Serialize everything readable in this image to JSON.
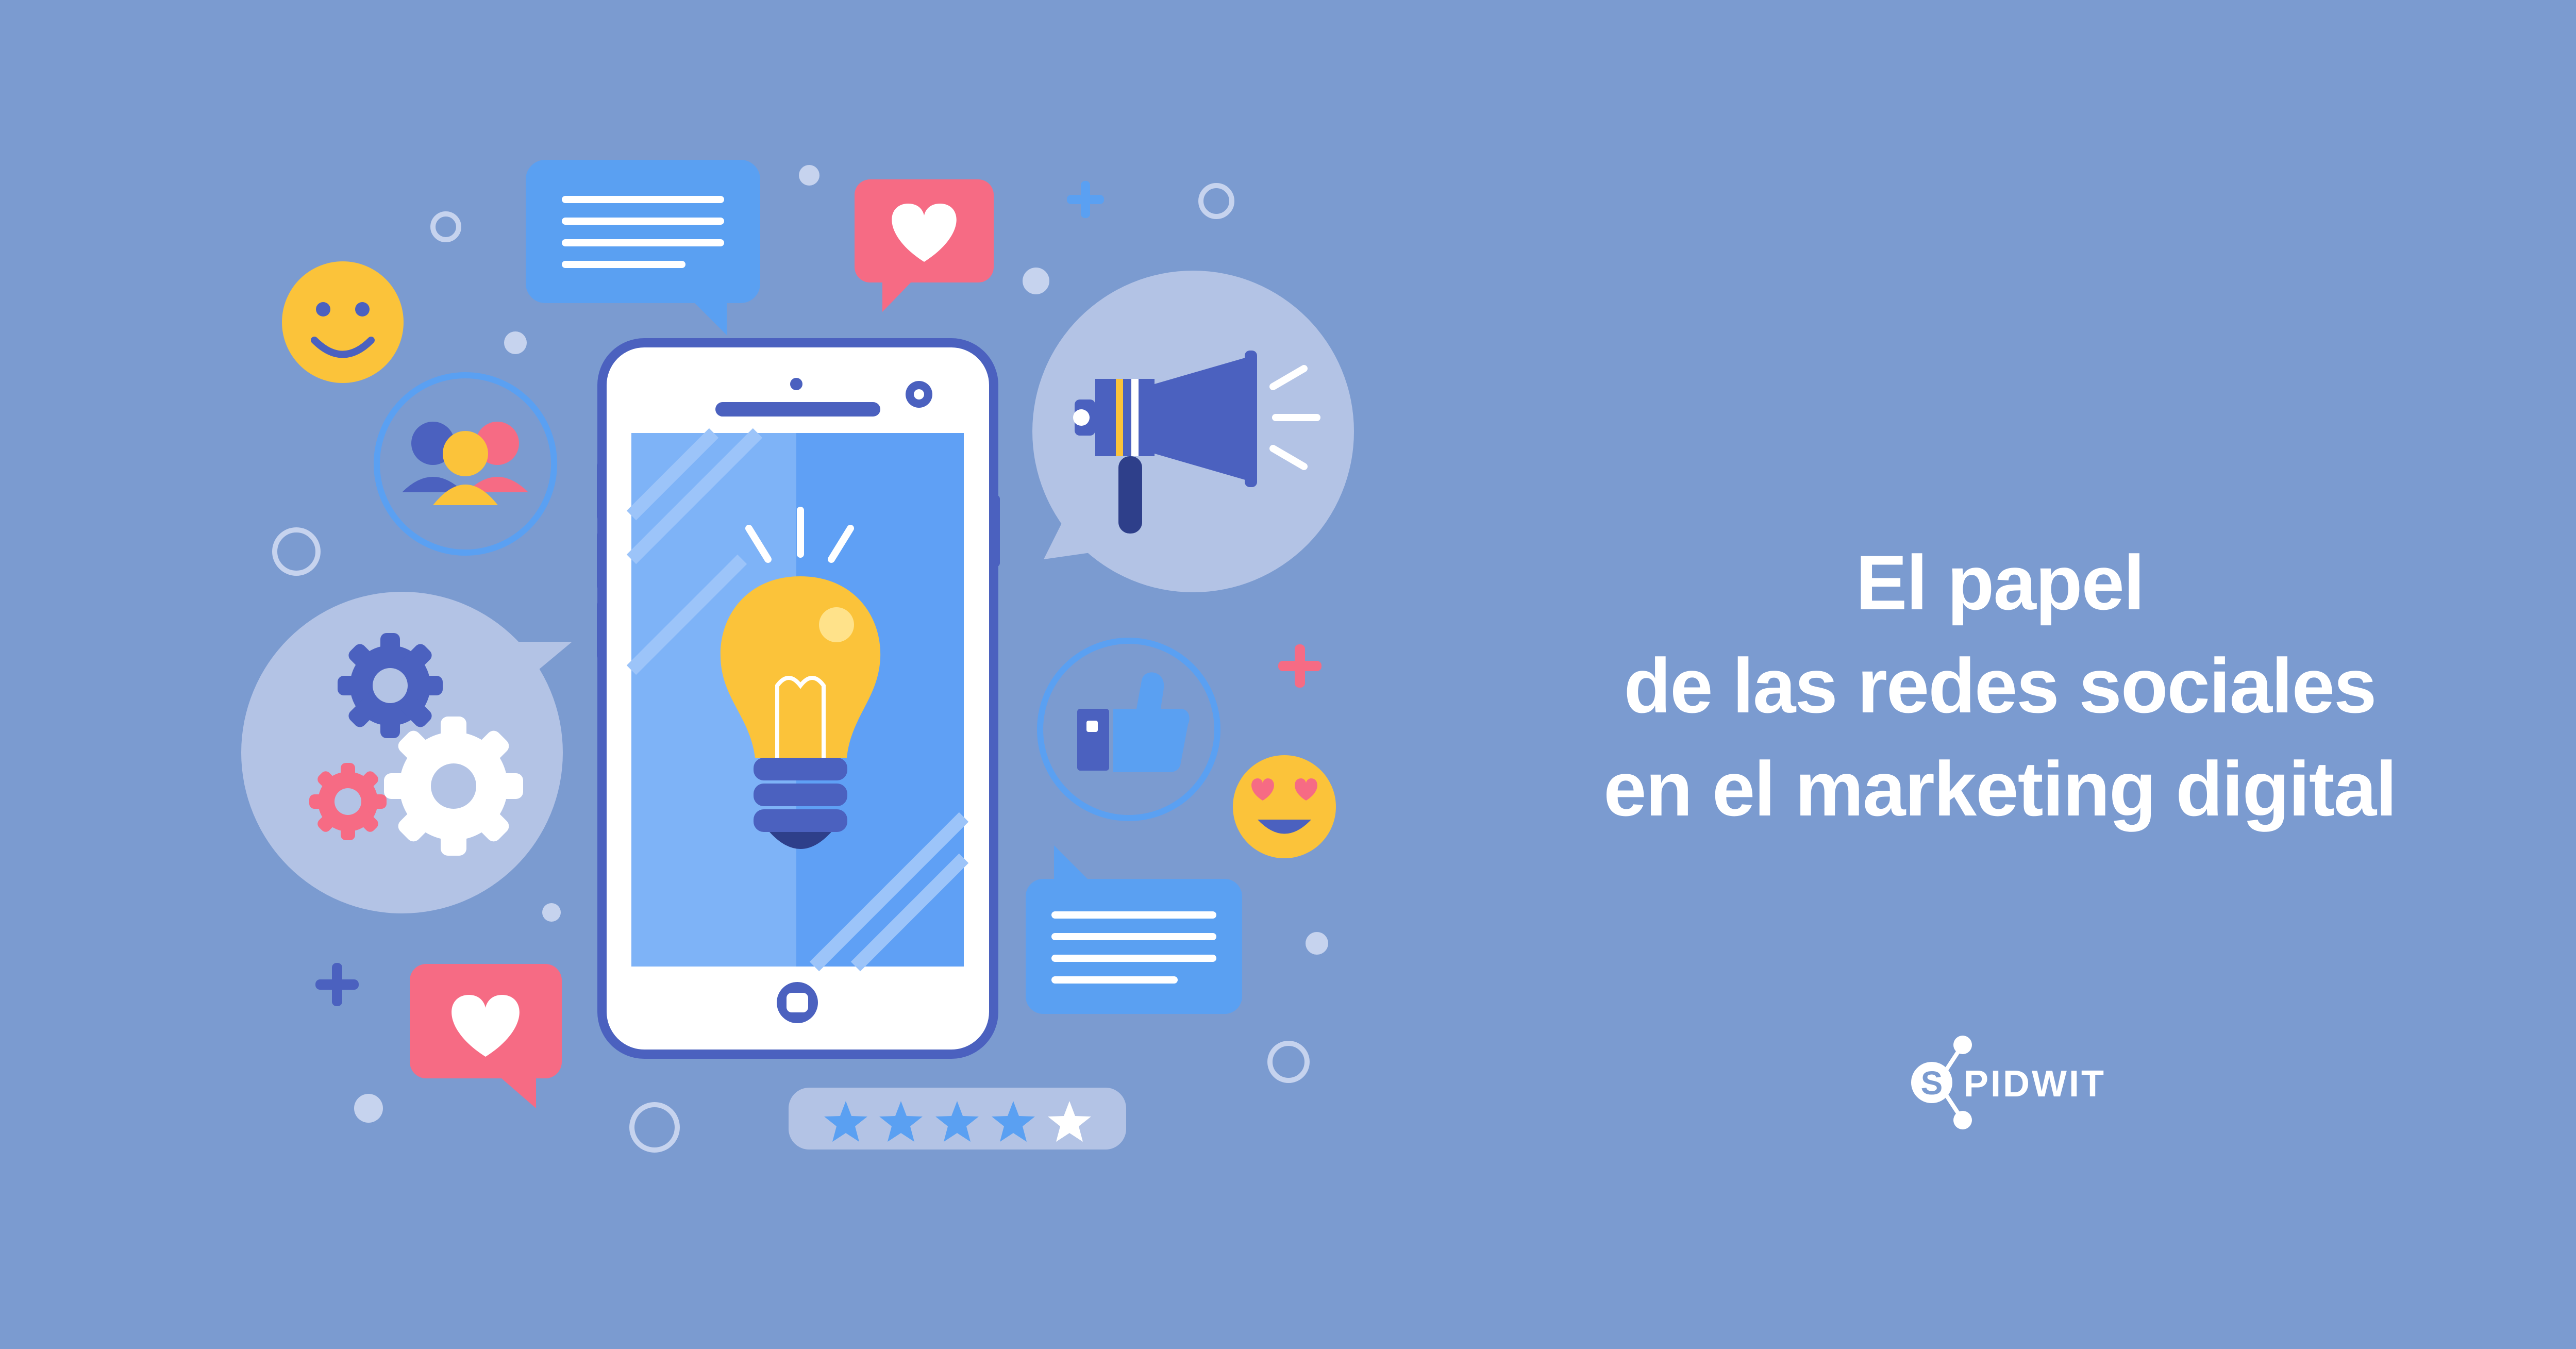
{
  "headline": {
    "line1": "El papel",
    "line2": "de las redes sociales",
    "line3": "en el marketing digital"
  },
  "brand": {
    "text": "PIDWIT",
    "logo_letter": "S"
  },
  "rating": {
    "stars_filled": 4,
    "stars_total": 5
  },
  "colors": {
    "background": "#7b9bd0",
    "phone_screen": "#5fa0f5",
    "bubble_blue": "#5aa0f2",
    "bubble_pink": "#f66b84",
    "bulb_yellow": "#fbc33a",
    "navy": "#4b61bf",
    "pale_circle": "#b3c3e5"
  },
  "icons": [
    "smiley-icon",
    "group-icon",
    "gears-icon",
    "heart-icon",
    "chat-bubble-icon",
    "megaphone-icon",
    "thumbs-up-icon",
    "heart-eyes-icon",
    "lightbulb-icon",
    "smartphone-icon",
    "star-icon",
    "plus-icon"
  ]
}
